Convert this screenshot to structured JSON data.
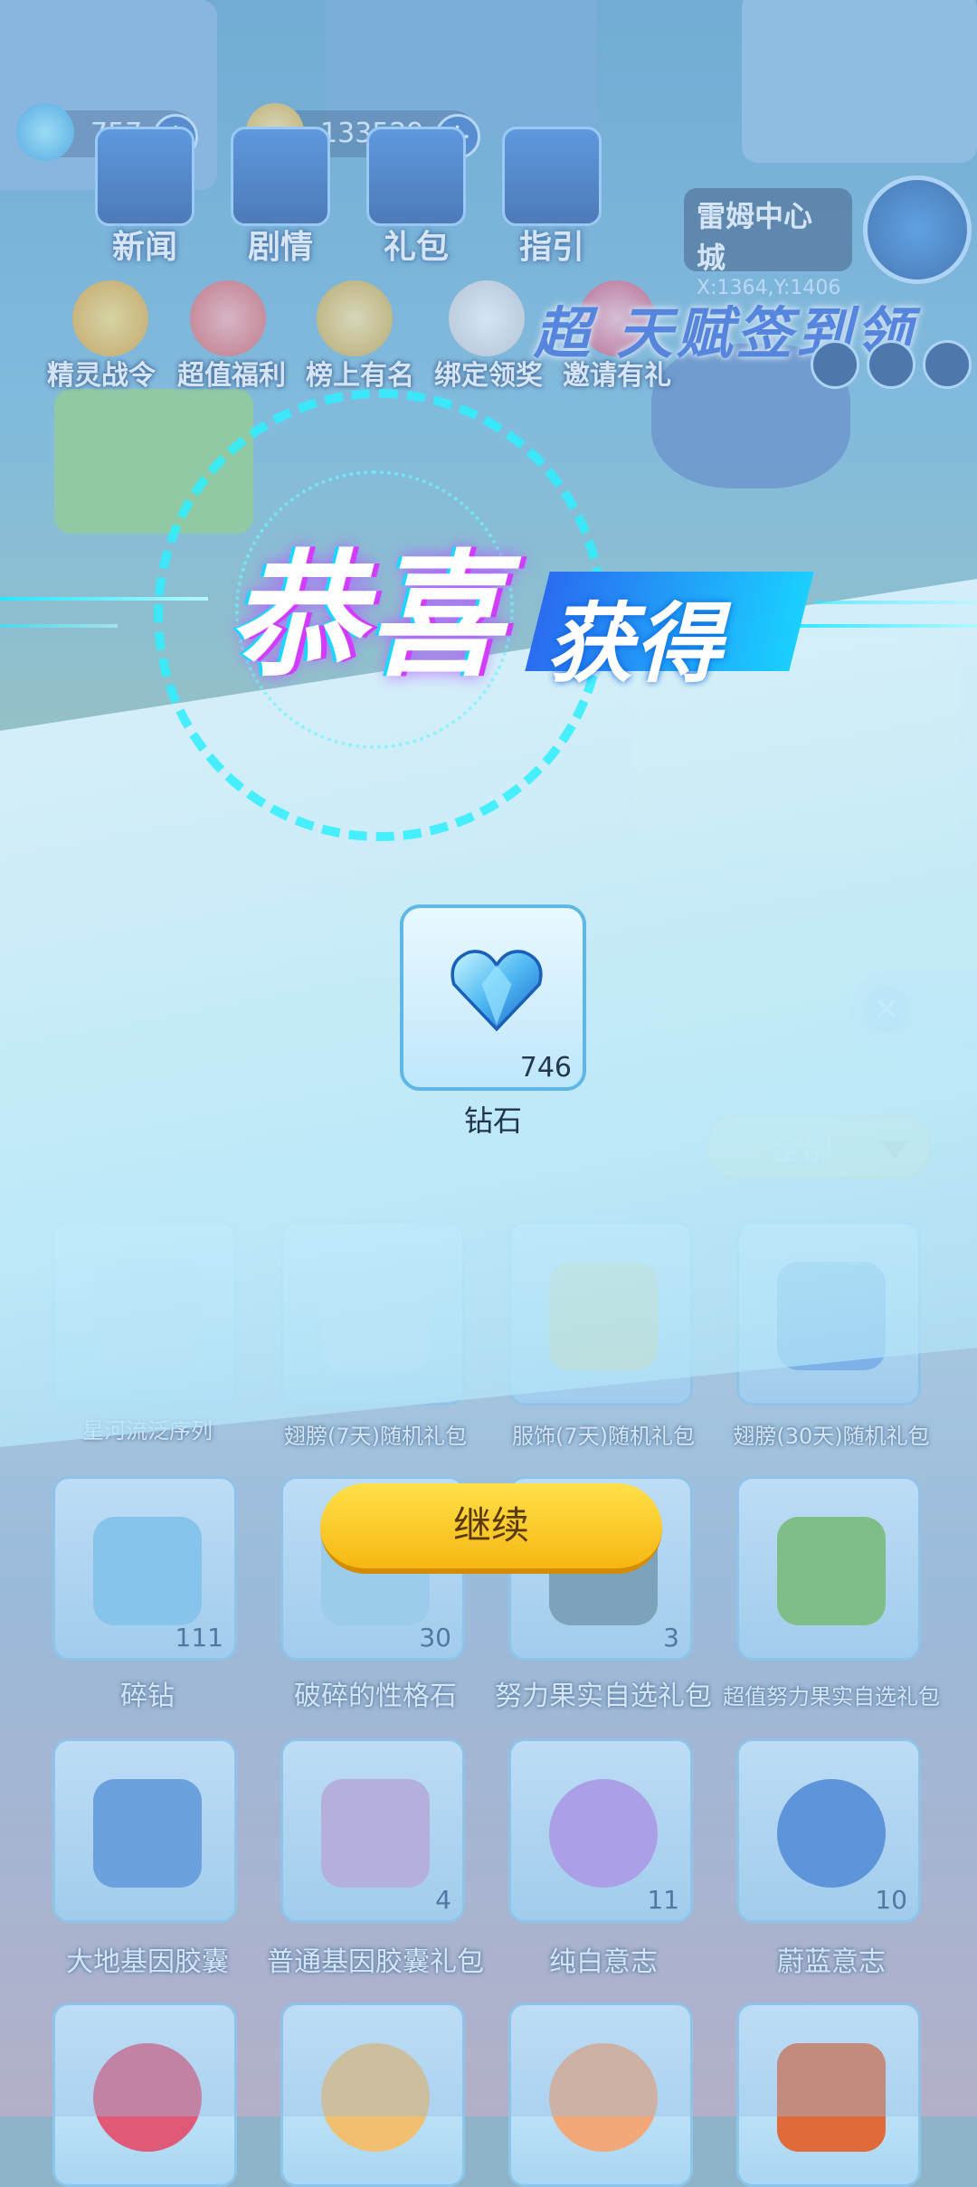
{
  "hud": {
    "diamond_count": "757",
    "coin_count": "133529",
    "menu": [
      {
        "label": "新闻",
        "icon": "news-icon"
      },
      {
        "label": "剧情",
        "icon": "story-icon"
      },
      {
        "label": "礼包",
        "icon": "gift-pack-icon"
      },
      {
        "label": "指引",
        "icon": "guide-icon"
      }
    ],
    "location": {
      "name": "雷姆中心城",
      "coords": "X:1364,Y:1406"
    },
    "activities": [
      "精灵战令",
      "超值福利",
      "榜上有名",
      "绑定领奖",
      "邀请有礼"
    ],
    "banner_text": "超 天赋签到领"
  },
  "bag": {
    "filter_label": "全部",
    "items": [
      {
        "label": "星河流泛序列",
        "count": ""
      },
      {
        "label": "翅膀(7天)随机礼包",
        "count": ""
      },
      {
        "label": "服饰(7天)随机礼包",
        "count": ""
      },
      {
        "label": "翅膀(30天)随机礼包",
        "count": ""
      },
      {
        "label": "碎钻",
        "count": "111"
      },
      {
        "label": "破碎的性格石",
        "count": "30"
      },
      {
        "label": "努力果实自选礼包",
        "count": "3"
      },
      {
        "label": "超值努力果实自选礼包",
        "count": ""
      },
      {
        "label": "大地基因胶囊",
        "count": ""
      },
      {
        "label": "普通基因胶囊礼包",
        "count": "4"
      },
      {
        "label": "纯白意志",
        "count": "11"
      },
      {
        "label": "蔚蓝意志",
        "count": "10"
      }
    ]
  },
  "popup": {
    "title_main": "恭喜",
    "title_sub": "获得",
    "reward": {
      "name": "钻石",
      "count": "746",
      "icon": "diamond-heart-icon"
    },
    "continue_label": "继续"
  },
  "colors": {
    "accent_cyan": "#27e6ff",
    "title_magenta": "#d23cff",
    "button_yellow": "#f6b711"
  }
}
